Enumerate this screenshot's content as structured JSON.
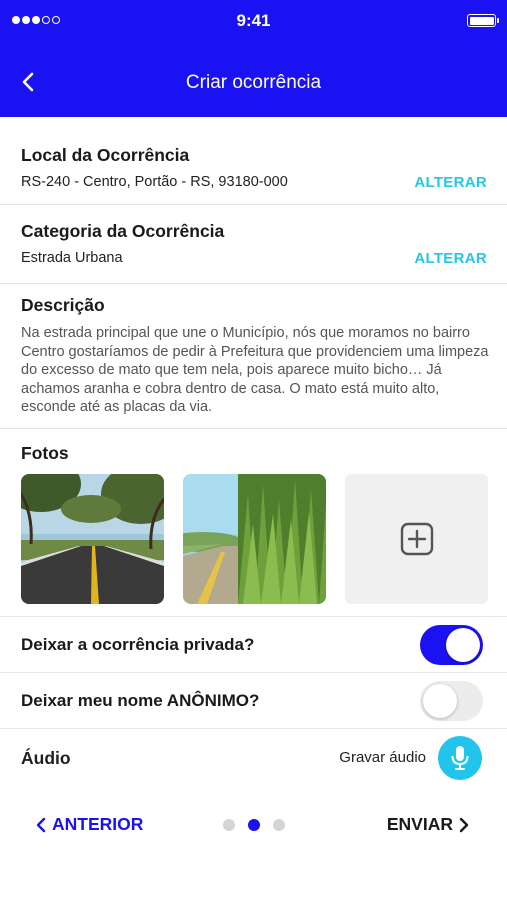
{
  "status_bar": {
    "time": "9:41"
  },
  "header": {
    "title": "Criar ocorrência"
  },
  "location": {
    "title": "Local da Ocorrência",
    "value": "RS-240 - Centro, Portão - RS, 93180-000",
    "action_label": "ALTERAR"
  },
  "category": {
    "title": "Categoria da Ocorrência",
    "value": "Estrada Urbana",
    "action_label": "ALTERAR"
  },
  "description": {
    "title": "Descrição",
    "text": "Na estrada principal que une o Município, nós que moramos no bairro Centro gostaríamos de pedir à Prefeitura que providenciem uma limpeza do excesso de mato que tem nela, pois aparece muito bicho… Já achamos aranha e cobra dentro de casa. O mato está muito alto, esconde até as placas da via."
  },
  "photos": {
    "title": "Fotos"
  },
  "options": {
    "private_label": "Deixar a ocorrência privada?",
    "private_on": true,
    "anonymous_label": "Deixar meu nome ANÔNIMO?",
    "anonymous_on": false
  },
  "audio": {
    "title": "Áudio",
    "record_label": "Gravar áudio"
  },
  "footer": {
    "prev_label": "ANTERIOR",
    "next_label": "ENVIAR",
    "current_step": 2,
    "total_steps": 3
  },
  "colors": {
    "primary": "#1a12f2",
    "accent": "#25c6e8",
    "mic": "#22c4ec"
  }
}
